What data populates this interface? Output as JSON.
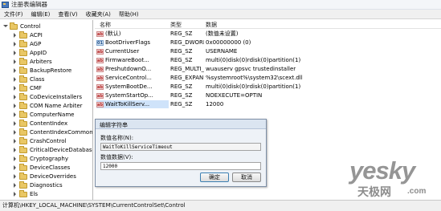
{
  "window": {
    "title": "注册表编辑器"
  },
  "menu": [
    "文件(F)",
    "编辑(E)",
    "查看(V)",
    "收藏夹(A)",
    "帮助(H)"
  ],
  "tree": {
    "root": "Control",
    "items": [
      "ACPI",
      "AGP",
      "AppID",
      "Arbiters",
      "BackupRestore",
      "Class",
      "CMF",
      "CoDeviceInstallers",
      "COM Name Arbiter",
      "ComputerName",
      "ContentIndex",
      "ContentIndexCommon",
      "CrashControl",
      "CriticalDeviceDatabase",
      "Cryptography",
      "DeviceClasses",
      "DeviceOverrides",
      "Diagnostics",
      "Els"
    ]
  },
  "list": {
    "headers": {
      "name": "名称",
      "type": "类型",
      "data": "数据"
    },
    "rows": [
      {
        "name": "(默认)",
        "type": "REG_SZ",
        "data": "(数值未设置)",
        "icon": "string-value-icon"
      },
      {
        "name": "BootDriverFlags",
        "type": "REG_DWORD",
        "data": "0x00000000 (0)",
        "icon": "binary-value-icon"
      },
      {
        "name": "CurrentUser",
        "type": "REG_SZ",
        "data": "USERNAME",
        "icon": "string-value-icon"
      },
      {
        "name": "FirmwareBoot...",
        "type": "REG_SZ",
        "data": "multi(0)disk(0)rdisk(0)partition(1)",
        "icon": "string-value-icon"
      },
      {
        "name": "PreshutdownO...",
        "type": "REG_MULTI_SZ",
        "data": "wuauserv gpsvc trustedinstaller",
        "icon": "string-value-icon"
      },
      {
        "name": "ServiceControl...",
        "type": "REG_EXPAND_SZ",
        "data": "%systemroot%\\system32\\scext.dll",
        "icon": "string-value-icon"
      },
      {
        "name": "SystemBootDe...",
        "type": "REG_SZ",
        "data": "multi(0)disk(0)rdisk(0)partition(1)",
        "icon": "string-value-icon"
      },
      {
        "name": "SystemStartOp...",
        "type": "REG_SZ",
        "data": " NOEXECUTE=OPTIN",
        "icon": "string-value-icon"
      },
      {
        "name": "WaitToKillServ...",
        "type": "REG_SZ",
        "data": "12000",
        "icon": "string-value-icon"
      }
    ]
  },
  "dialog": {
    "title": "编辑字符串",
    "name_label": "数值名称(N):",
    "name_value": "WaitToKillServiceTimeout",
    "data_label": "数值数据(V):",
    "data_value": "12000",
    "ok": "确定",
    "cancel": "取消"
  },
  "status": "计算机\\HKEY_LOCAL_MACHINE\\SYSTEM\\CurrentControlSet\\Control",
  "watermark": {
    "brand": "yesky",
    "cn": "天极网",
    "suffix": ".com"
  },
  "colors": {
    "selection": "#cfe3fa",
    "dialog_bg": "#eef2f7",
    "folder": "#e9c765"
  }
}
